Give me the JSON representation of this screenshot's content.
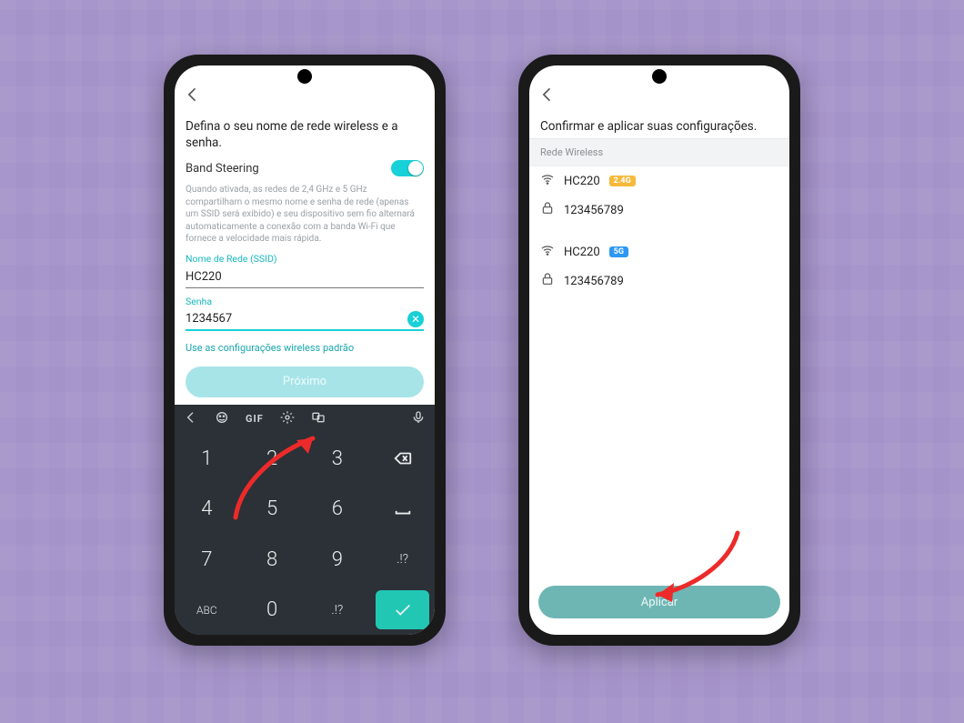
{
  "left": {
    "title": "Defina o seu nome de rede wireless e a senha.",
    "band_steering_label": "Band Steering",
    "band_steering_on": true,
    "description": "Quando ativada, as redes de 2,4 GHz e 5 GHz compartilham o mesmo nome e senha de rede (apenas um SSID será exibido) e seu dispositivo sem fio alternará automaticamente a conexão com a banda Wi-Fi que fornece a velocidade mais rápida.",
    "ssid_label": "Nome de Rede (SSID)",
    "ssid_value": "HC220",
    "password_label": "Senha",
    "password_value": "1234567",
    "default_link": "Use as configurações wireless padrão",
    "next_button": "Próximo",
    "kb_bar": {
      "gif": "GIF"
    },
    "keys": {
      "r1c1": "1",
      "r1c2": "2",
      "r1c3": "3",
      "r2c1": "4",
      "r2c2": "5",
      "r2c3": "6",
      "r3c1": "7",
      "r3c2": "8",
      "r3c3": "9",
      "r4c1": "ABC",
      "r4c2": "0",
      "r4c3": ".!?"
    }
  },
  "right": {
    "title": "Confirmar e aplicar suas configurações.",
    "section": "Rede Wireless",
    "net24": {
      "name": "HC220",
      "badge": "2.4G",
      "password": "123456789"
    },
    "net5g": {
      "name": "HC220",
      "badge": "5G",
      "password": "123456789"
    },
    "apply_button": "Aplicar"
  }
}
